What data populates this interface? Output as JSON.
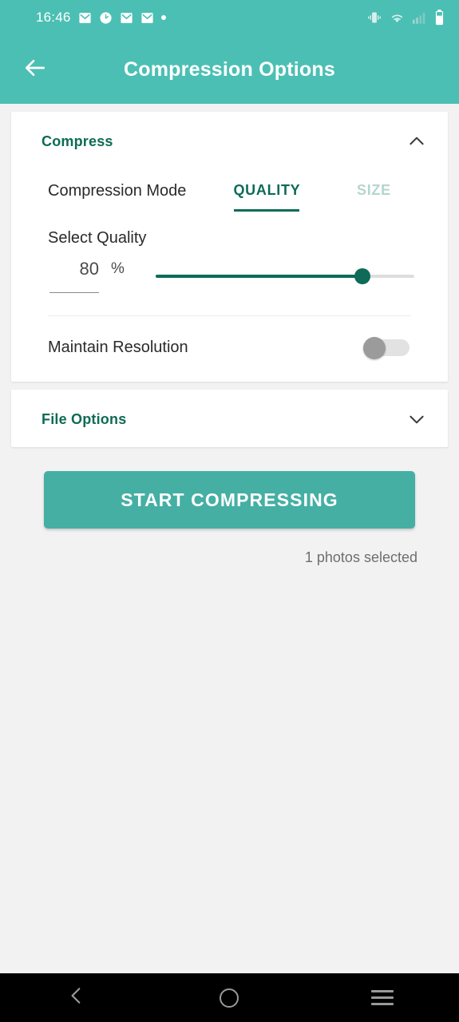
{
  "status_bar": {
    "time": "16:46",
    "left_icons": [
      "mail-icon",
      "clock-icon",
      "mail-icon",
      "mail-icon",
      "dot-icon"
    ],
    "right_icons": [
      "vibrate-icon",
      "wifi-icon",
      "cellular-signal-icon",
      "battery-icon"
    ]
  },
  "app_bar": {
    "back_icon": "back-arrow-icon",
    "title": "Compression Options"
  },
  "compress_card": {
    "title": "Compress",
    "expand_icon": "chevron-up-icon",
    "mode_label": "Compression Mode",
    "tabs": [
      {
        "label": "QUALITY",
        "active": true
      },
      {
        "label": "SIZE",
        "active": false
      }
    ],
    "quality_label": "Select Quality",
    "quality_value": "80",
    "quality_unit": "%",
    "slider_percent": 80,
    "maintain_resolution_label": "Maintain Resolution",
    "maintain_resolution_on": false
  },
  "file_options_card": {
    "title": "File Options",
    "expand_icon": "chevron-down-icon"
  },
  "action": {
    "start_button": "START COMPRESSING",
    "selected_count": "1 photos selected"
  },
  "nav_bar": {
    "back": "nav-back-icon",
    "home": "nav-home-icon",
    "recents": "nav-recents-icon"
  },
  "colors": {
    "brand_teal": "#4cbfb4",
    "button_teal": "#45afa4",
    "accent_dark_teal": "#0d6b58",
    "inactive_tab": "#b6d5ce",
    "page_bg": "#f2f2f2"
  }
}
